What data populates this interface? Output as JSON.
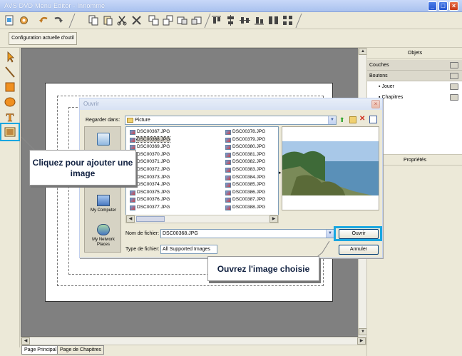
{
  "window": {
    "title": "AVS DVD Menu Editor - Innommé",
    "minimize": "_",
    "maximize": "□",
    "close": "×"
  },
  "config_tab": {
    "label": "Configuration actuelle d'outil"
  },
  "right_panel": {
    "objects_header": "Objets",
    "layers_label": "Couches",
    "buttons_label": "Boutons",
    "buttons": [
      "Jouer",
      "Chapitres"
    ],
    "properties_header": "Propriétés"
  },
  "page_tabs": [
    "Page Principal",
    "Page de Chapitres"
  ],
  "dialog": {
    "title": "Ouvrir",
    "look_in_label": "Regarder dans:",
    "look_in_value": "Picture",
    "places": [
      "My Computer",
      "My Network Places"
    ],
    "files_col1": [
      "DSC00367.JPG",
      "DSC00368.JPG",
      "DSC00369.JPG",
      "DSC00370.JPG",
      "DSC00371.JPG",
      "DSC00372.JPG",
      "DSC00373.JPG",
      "DSC00374.JPG",
      "DSC00375.JPG",
      "DSC00376.JPG",
      "DSC00377.JPG"
    ],
    "files_col2": [
      "DSC00378.JPG",
      "DSC00379.JPG",
      "DSC00380.JPG",
      "DSC00381.JPG",
      "DSC00382.JPG",
      "DSC00383.JPG",
      "DSC00384.JPG",
      "DSC00385.JPG",
      "DSC00386.JPG",
      "DSC00387.JPG",
      "DSC00388.JPG"
    ],
    "selected_file": "DSC00368.JPG",
    "filename_label": "Nom de fichier:",
    "filename_value": "DSC00368.JPG",
    "filetype_label": "Type de fichier:",
    "filetype_value": "All Supported Images",
    "open_button": "Ouvrir",
    "cancel_button": "Annuler"
  },
  "callouts": {
    "add_image": "Cliquez pour ajouter une image",
    "open_image": "Ouvrez l'image choisie"
  },
  "colors": {
    "highlight": "#19a6e0",
    "canvas": "#808080",
    "chrome": "#ece9d8"
  },
  "icons": [
    "undo-icon",
    "redo-icon",
    "copy-icon",
    "paste-icon",
    "cut-icon",
    "delete-icon",
    "arrow-tool-icon",
    "line-tool-icon",
    "rectangle-tool-icon",
    "ellipse-tool-icon",
    "text-tool-icon",
    "image-tool-icon"
  ]
}
